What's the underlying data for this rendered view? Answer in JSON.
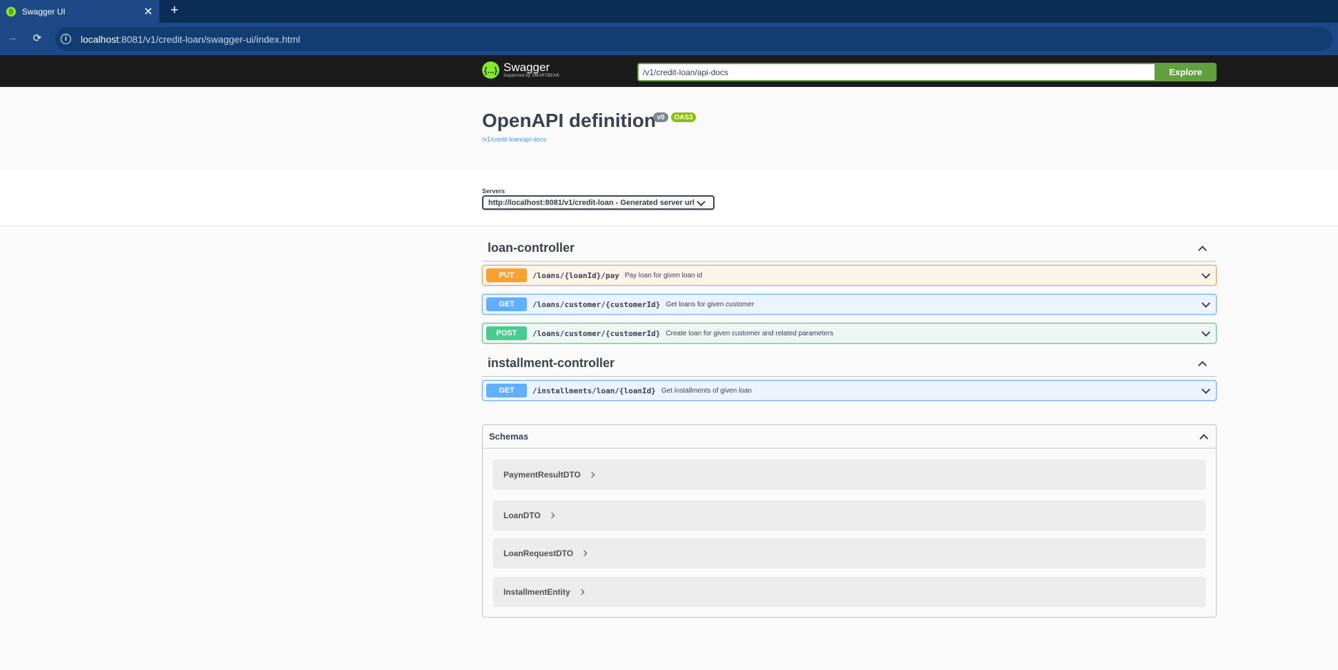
{
  "browser": {
    "tab_title": "Swagger UI",
    "tab_close": "✕",
    "new_tab": "+",
    "url_host": "localhost",
    "url_rest": ":8081/v1/credit-loan/swagger-ui/index.html"
  },
  "topbar": {
    "logo_text": "Swagger",
    "logo_sub": "Supported by SMARTBEAR",
    "logo_glyph": "{...}",
    "spec_url": "/v1/credit-loan/api-docs",
    "explore_label": "Explore"
  },
  "info": {
    "title": "OpenAPI definition",
    "version_badge": "v0",
    "oas_badge": "OAS3",
    "docs_link": "/v1/credit-loan/api-docs"
  },
  "servers": {
    "label": "Servers",
    "selected": "http://localhost:8081/v1/credit-loan - Generated server url"
  },
  "controllers": [
    {
      "name": "loan-controller",
      "operations": [
        {
          "method": "PUT",
          "path": "/loans/{loanId}/pay",
          "summary": "Pay loan for given loan id"
        },
        {
          "method": "GET",
          "path": "/loans/customer/{customerId}",
          "summary": "Get loans for given customer"
        },
        {
          "method": "POST",
          "path": "/loans/customer/{customerId}",
          "summary": "Create loan for given customer and related parameters"
        }
      ]
    },
    {
      "name": "installment-controller",
      "operations": [
        {
          "method": "GET",
          "path": "/installments/loan/{loanId}",
          "summary": "Get installments of given loan"
        }
      ]
    }
  ],
  "schemas": {
    "label": "Schemas",
    "models": [
      "PaymentResultDTO",
      "LoanDTO",
      "LoanRequestDTO",
      "InstallmentEntity"
    ]
  },
  "colors": {
    "put": "#fca130",
    "get": "#61affe",
    "post": "#49cc90",
    "explore": "#62a03f",
    "swagger_green": "#85ea2d"
  }
}
